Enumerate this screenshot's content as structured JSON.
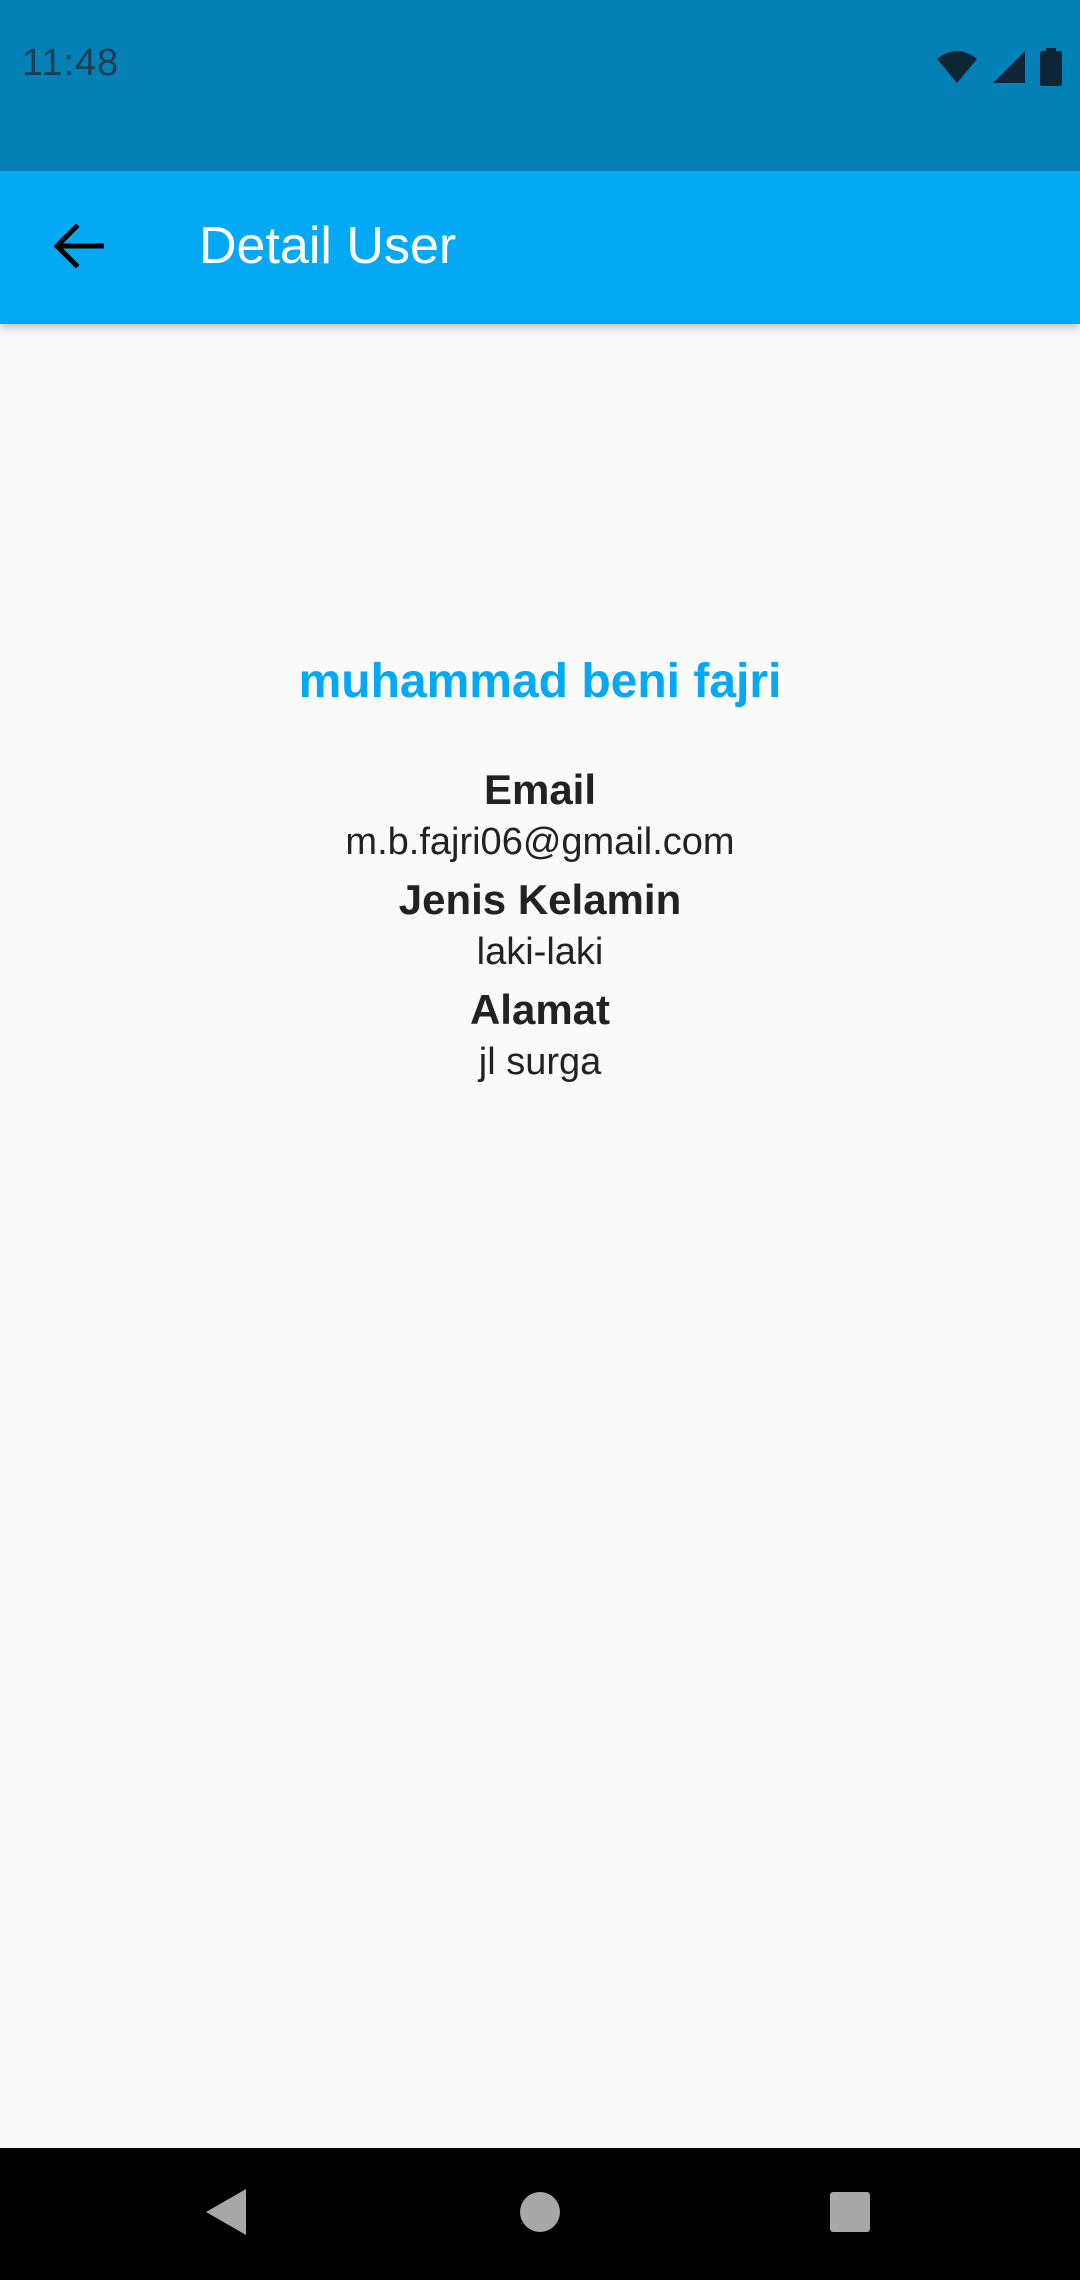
{
  "status_bar": {
    "time": "11:48",
    "icons": [
      "wifi-icon",
      "cell-signal-icon",
      "battery-icon"
    ],
    "background": "#0380b5"
  },
  "app_bar": {
    "title": "Detail User",
    "back_icon": "arrow-back-icon",
    "background": "#03a9f4"
  },
  "user": {
    "name": "muhammad beni fajri",
    "fields": [
      {
        "label": "Email",
        "value": "m.b.fajri06@gmail.com"
      },
      {
        "label": "Jenis Kelamin",
        "value": "laki-laki"
      },
      {
        "label": "Alamat",
        "value": "jl surga"
      }
    ]
  },
  "nav_bar": {
    "buttons": [
      "back-triangle-icon",
      "home-circle-icon",
      "recents-square-icon"
    ]
  },
  "colors": {
    "accent": "#03a9f4",
    "text": "#222222",
    "page_background": "#fafafa"
  }
}
